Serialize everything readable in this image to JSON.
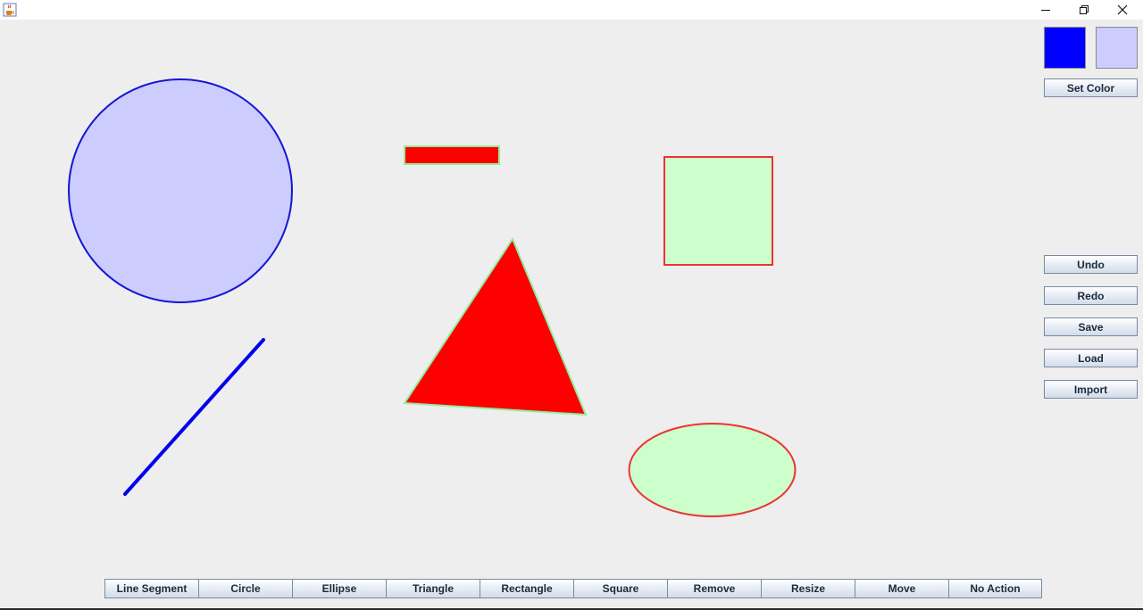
{
  "window": {
    "app_icon": "java-coffee-cup-icon",
    "minimize_icon": "minimize-icon",
    "restore_icon": "restore-icon",
    "close_icon": "close-icon"
  },
  "colors": {
    "primary": "#0000ff",
    "secondary": "#ccccff",
    "background": "#eeeeee"
  },
  "side_panel": {
    "set_color_label": "Set Color",
    "buttons": [
      "Undo",
      "Redo",
      "Save",
      "Load",
      "Import"
    ]
  },
  "toolbar": {
    "buttons": [
      "Line Segment",
      "Circle",
      "Ellipse",
      "Triangle",
      "Rectangle",
      "Square",
      "Remove",
      "Resize",
      "Move",
      "No Action"
    ]
  },
  "shapes": [
    {
      "type": "circle",
      "stroke": "#1515d6",
      "fill": "#ccccff"
    },
    {
      "type": "line-segment",
      "stroke": "#0000ee"
    },
    {
      "type": "rectangle",
      "stroke": "#90eea0",
      "fill": "#ff0000"
    },
    {
      "type": "triangle",
      "stroke": "#90eea0",
      "fill": "#ff0000"
    },
    {
      "type": "square",
      "stroke": "#ee3333",
      "fill": "#ccffcc"
    },
    {
      "type": "ellipse",
      "stroke": "#ee3333",
      "fill": "#ccffcc"
    }
  ]
}
